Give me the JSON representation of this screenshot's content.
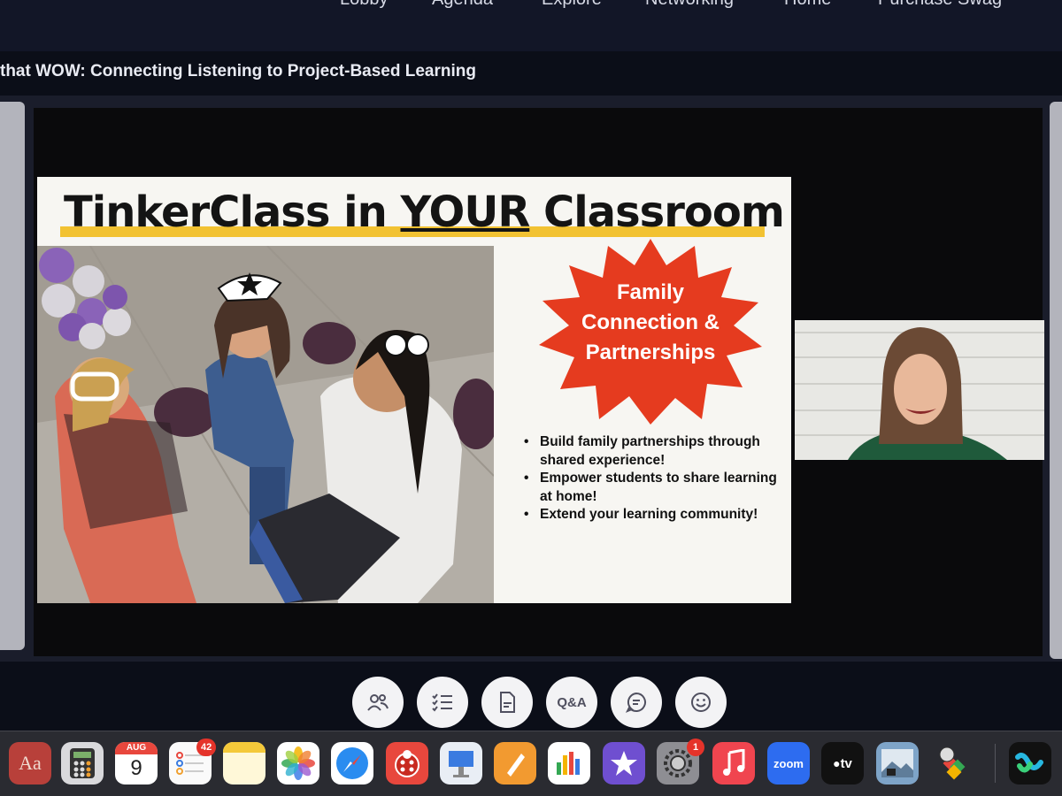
{
  "nav": {
    "items": [
      "Lobby",
      "Agenda",
      "Explore",
      "Networking",
      "Home",
      "Purchase Swag"
    ]
  },
  "session": {
    "title": "that WOW: Connecting Listening to Project-Based Learning"
  },
  "slide": {
    "title_part1": "TinkerClass in ",
    "title_part2": "YOUR",
    "title_part3": " Classroom",
    "burst_line1": "Family",
    "burst_line2": "Connection &",
    "burst_line3": "Partnerships",
    "bullets": [
      "Build family partnerships through shared experience!",
      "Empower students to share learning at home!",
      "Extend your learning community!"
    ],
    "colors": {
      "burst": "#e53b1f",
      "highlight": "#f2c232"
    }
  },
  "controls": {
    "qa_label": "Q&A"
  },
  "dock": {
    "calendar_month": "AUG",
    "calendar_day": "9",
    "reminders_badge": "42",
    "settings_badge": "1",
    "dictionary_label": "Aa",
    "zoom_label": "zoom",
    "tv_label": "tv"
  }
}
